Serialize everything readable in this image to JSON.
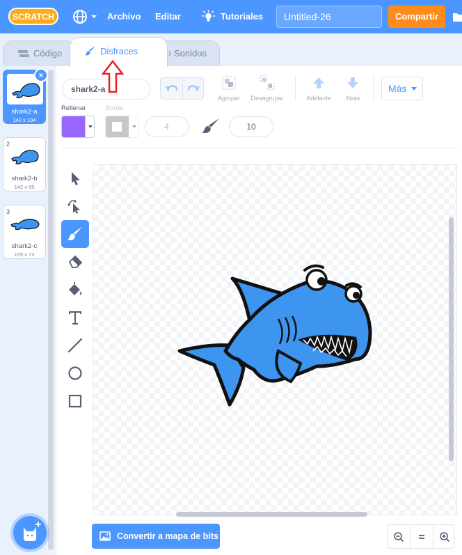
{
  "menubar": {
    "logo_text": "SCRATCH",
    "archivo": "Archivo",
    "editar": "Editar",
    "tutoriales": "Tutoriales",
    "project_title": "Untitled-26",
    "share": "Compartir"
  },
  "tabs": {
    "code": "Código",
    "costumes": "Disfraces",
    "sounds": "Sonidos"
  },
  "costumes": [
    {
      "num": "1",
      "name": "shark2-a",
      "size": "142 x 104",
      "selected": true
    },
    {
      "num": "2",
      "name": "shark2-b",
      "size": "142 x 95",
      "selected": false
    },
    {
      "num": "3",
      "name": "shark2-c",
      "size": "155 x 73",
      "selected": false
    }
  ],
  "editor": {
    "costume_name": "shark2-a",
    "group": "Agrupar",
    "ungroup": "Desagrupar",
    "forward": "Adelante",
    "backward": "Atrás",
    "more": "Más",
    "fill_label": "Rellenar",
    "outline_label": "Borde",
    "outline_width": "4",
    "brush_size": "10",
    "fill_color": "#9966ff",
    "convert_bitmap": "Convertir a mapa de bits"
  },
  "colors": {
    "accent": "#4c97ff",
    "share": "#ff8c1a",
    "annotation_arrow": "#e8201f"
  }
}
